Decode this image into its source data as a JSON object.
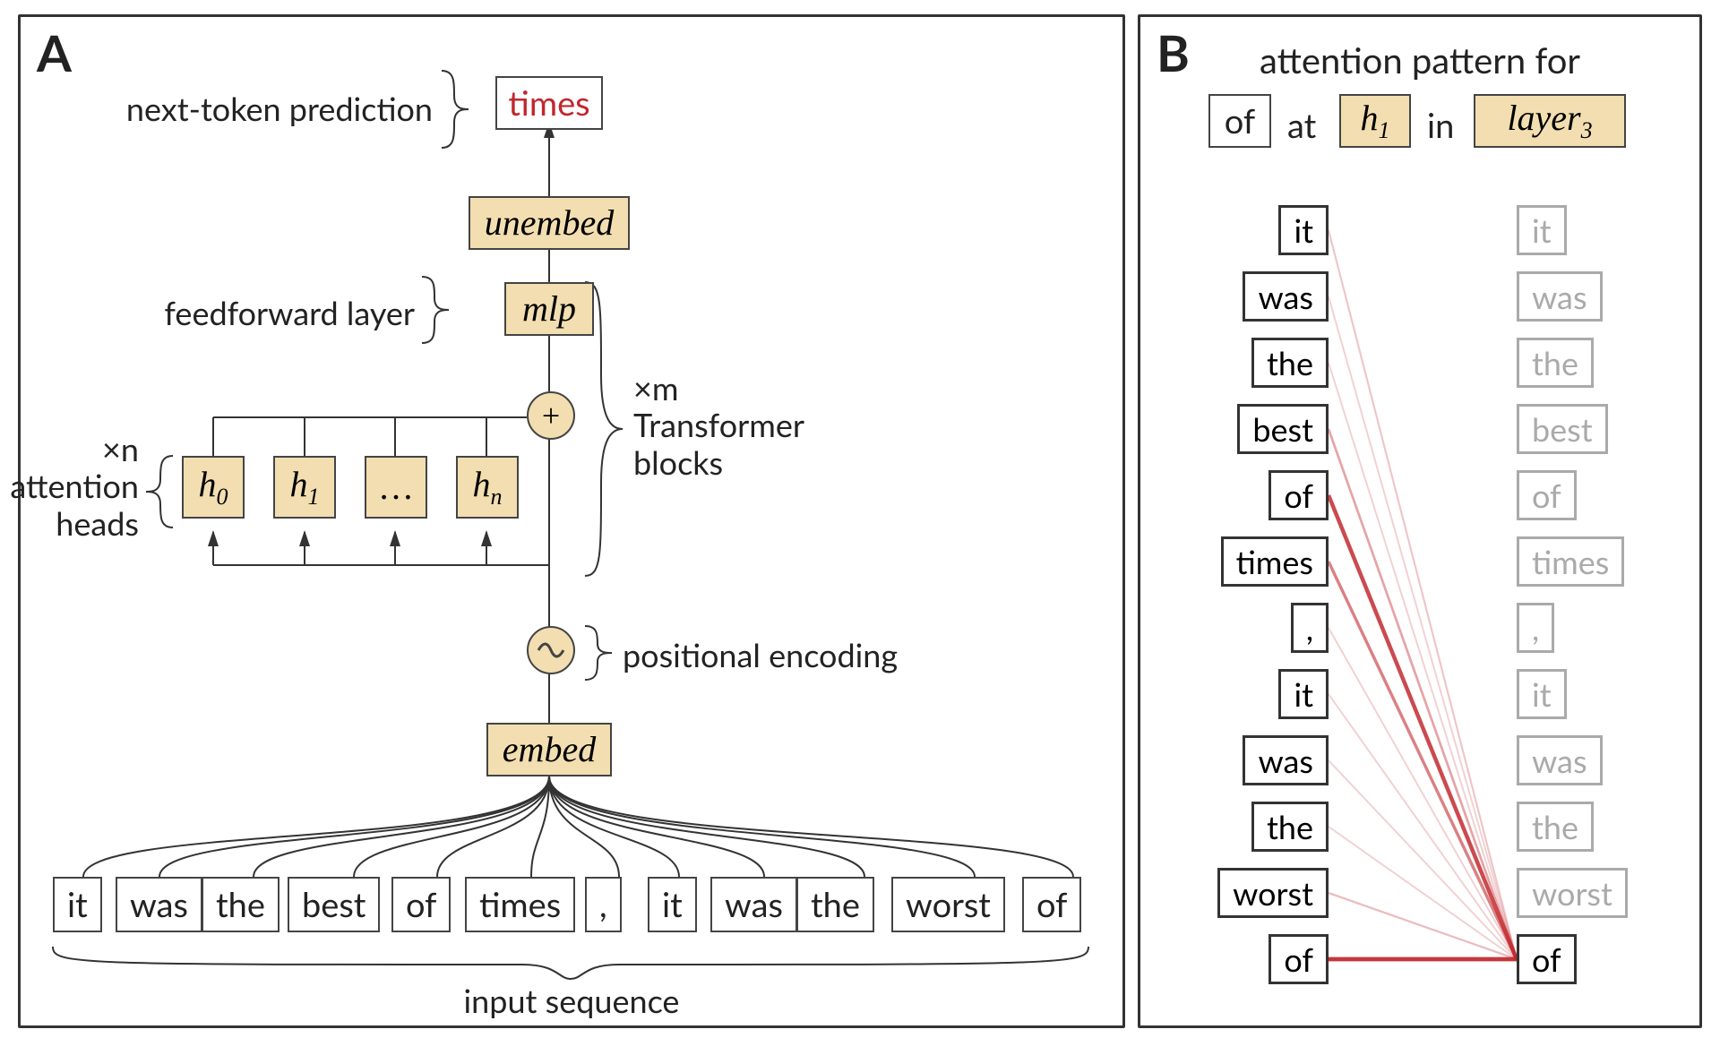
{
  "panelA": {
    "label": "A",
    "next_token_caption": "next-token prediction",
    "predicted_token": "times",
    "unembed": "unembed",
    "mlp": "mlp",
    "mlp_caption": "feedforward layer",
    "heads_caption_top": "×n",
    "heads_caption_mid": "attention",
    "heads_caption_bot": "heads",
    "heads": [
      "h0",
      "h1",
      "…",
      "hn"
    ],
    "blocks_caption_top": "×m",
    "blocks_caption_mid": "Transformer",
    "blocks_caption_bot": "blocks",
    "pos_enc_caption": "positional encoding",
    "embed": "embed",
    "input_tokens": [
      "it",
      "was",
      "the",
      "best",
      "of",
      "times",
      ",",
      "it",
      "was",
      "the",
      "worst",
      "of"
    ],
    "input_sequence_caption": "input sequence"
  },
  "panelB": {
    "label": "B",
    "title": "attention pattern for",
    "title_tokens": {
      "of": "of",
      "at": "at",
      "h1": "h1",
      "in": "in",
      "layer3": "layer3"
    },
    "tokens": [
      "it",
      "was",
      "the",
      "best",
      "of",
      "times",
      ",",
      "it",
      "was",
      "the",
      "worst",
      "of"
    ],
    "attention_weights": [
      0.18,
      0.12,
      0.12,
      0.35,
      0.85,
      0.55,
      0.12,
      0.12,
      0.12,
      0.12,
      0.22,
      0.95
    ]
  }
}
